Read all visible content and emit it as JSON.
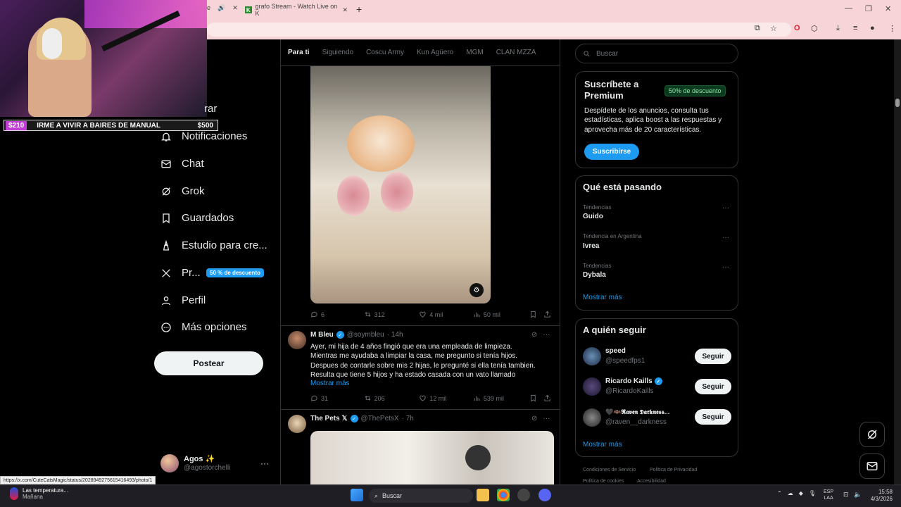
{
  "browser": {
    "tab_partial_label": "e",
    "tab2_favicon_letter": "K",
    "tab2_title": "grafo Stream - Watch Live on K",
    "new_tab": "+",
    "minimize": "—",
    "restore": "❐",
    "close": "✕"
  },
  "stream_overlay": {
    "ticker_left": "$210",
    "ticker_message": "IRME A VIVIR A BAIRES DE MANUAL",
    "ticker_right": "$500"
  },
  "sidebar": {
    "partial_item": "rar",
    "items": [
      {
        "label": "Notificaciones",
        "icon": "bell-icon"
      },
      {
        "label": "Chat",
        "icon": "mail-icon"
      },
      {
        "label": "Grok",
        "icon": "grok-icon"
      },
      {
        "label": "Guardados",
        "icon": "bookmark-icon"
      },
      {
        "label": "Estudio para cre...",
        "icon": "creator-studio-icon"
      },
      {
        "label": "Pr...",
        "icon": "x-logo-icon"
      },
      {
        "label": "Perfil",
        "icon": "person-icon"
      },
      {
        "label": "Más opciones",
        "icon": "more-circle-icon"
      }
    ],
    "premium_badge": "50 % de descuento",
    "post_button": "Postear",
    "account_name": "Agos ✨",
    "account_handle": "@agostorchelli",
    "account_more": "···"
  },
  "status_url": "https://x.com/CuteCatsMagic/status/2028949275615416493/photo/1",
  "feed": {
    "tabs": [
      "Para ti",
      "Siguiendo",
      "Coscu Army",
      "Kun Agüero",
      "MGM",
      "CLAN MZZA"
    ],
    "active_tab": "Para ti",
    "post1": {
      "replies": "6",
      "reposts": "312",
      "likes": "4 mil",
      "views": "50 mil"
    },
    "post2": {
      "name": "M Bleu",
      "handle": "@soymbleu",
      "time": "· 14h",
      "text": "Ayer, mi hija de 4 años fingió que era una empleada de limpieza.\nMientras me ayudaba a limpiar la casa, me pregunto si tenía hijos.\nDespues de contarle sobre mis 2 hijas, le pregunté si ella tenía tambien.\nResulta que tiene 5 hijos y ha estado casada con un vato llamado",
      "show_more": "Mostrar más",
      "replies": "31",
      "reposts": "206",
      "likes": "12 mil",
      "views": "539 mil"
    },
    "post3": {
      "name": "The Pets 𝕏",
      "handle": "@ThePetsX",
      "time": "· 7h"
    }
  },
  "right": {
    "search_placeholder": "Buscar",
    "premium": {
      "title": "Suscríbete a Premium",
      "badge": "50% de descuento",
      "desc": "Despídete de los anuncios, consulta tus estadísticas, aplica boost a las respuestas y aprovecha más de 20 características.",
      "button": "Suscribirse"
    },
    "trends_title": "Qué está pasando",
    "trends": [
      {
        "category": "Tendencias",
        "name": "Guido"
      },
      {
        "category": "Tendencia en Argentina",
        "name": "Ivrea"
      },
      {
        "category": "Tendencias",
        "name": "Dybala"
      }
    ],
    "trends_more": "Mostrar más",
    "follow_title": "A quién seguir",
    "follow": [
      {
        "name": "speed",
        "handle": "@speedfps1",
        "button": "Seguir"
      },
      {
        "name": "Ricardo Kaills",
        "handle": "@RicardoKaills",
        "button": "Seguir"
      },
      {
        "name": "🖤🦇𝕽𝖆𝖛𝖊𝖓 𝕯𝖆𝖗𝖐𝖓𝖊𝖘𝖘...",
        "handle": "@raven__darkness",
        "button": "Seguir"
      }
    ],
    "follow_more": "Mostrar más",
    "footer": [
      "Condiciones de Servicio",
      "Política de Privacidad",
      "Política de cookies",
      "Accesibilidad"
    ]
  },
  "taskbar": {
    "weather_line1": "Las temperatura...",
    "weather_line2": "Mañana",
    "search": "Buscar",
    "lang1": "ESP",
    "lang2": "LAA",
    "time": "15:58",
    "date": "4/3/2026"
  },
  "colors": {
    "accent": "#1d9bf0",
    "tabbar": "#f6d4d7",
    "ticker_accent": "#c23ad8"
  }
}
